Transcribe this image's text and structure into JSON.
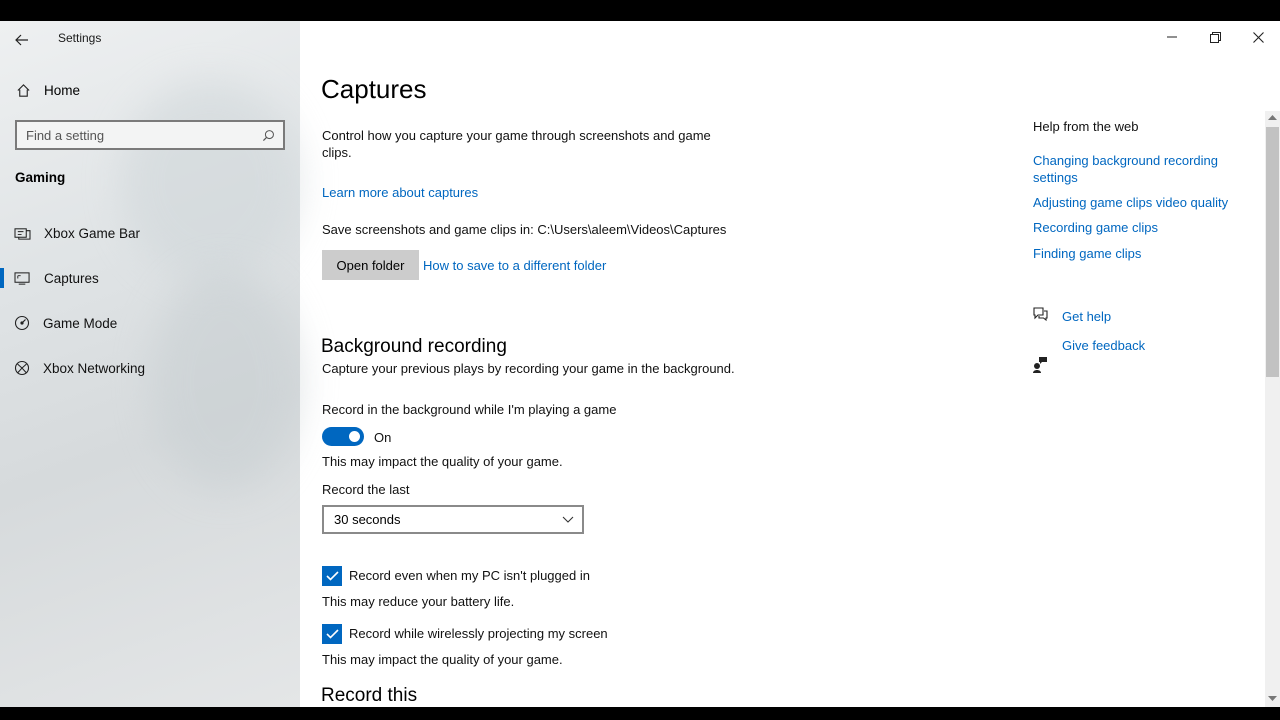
{
  "window": {
    "app_title": "Settings"
  },
  "sidebar": {
    "home_label": "Home",
    "search_placeholder": "Find a setting",
    "section_heading": "Gaming",
    "items": [
      {
        "label": "Xbox Game Bar",
        "icon": "xbox-game-bar-icon",
        "selected": false
      },
      {
        "label": "Captures",
        "icon": "captures-icon",
        "selected": true
      },
      {
        "label": "Game Mode",
        "icon": "game-mode-icon",
        "selected": false
      },
      {
        "label": "Xbox Networking",
        "icon": "xbox-icon",
        "selected": false
      }
    ]
  },
  "main": {
    "title": "Captures",
    "description": "Control how you capture your game through screenshots and game clips.",
    "learn_more_link": "Learn more about captures",
    "save_location_text": "Save screenshots and game clips in: C:\\Users\\aleem\\Videos\\Captures",
    "open_folder_label": "Open folder",
    "different_folder_link": "How to save to a different folder",
    "background_recording": {
      "heading": "Background recording",
      "description": "Capture your previous plays by recording your game in the background.",
      "toggle_label": "Record in the background while I'm playing a game",
      "toggle_state": "On",
      "toggle_note": "This may impact the quality of your game.",
      "record_last_label": "Record the last",
      "record_last_value": "30 seconds",
      "checkbox_plugged_label": "Record even when my PC isn't plugged in",
      "checkbox_plugged_note": "This may reduce your battery life.",
      "checkbox_projecting_label": "Record while wirelessly projecting my screen",
      "checkbox_projecting_note": "This may impact the quality of your game."
    },
    "record_this_heading": "Record this"
  },
  "help_panel": {
    "heading": "Help from the web",
    "links": [
      "Changing background recording settings",
      "Adjusting game clips video quality",
      "Recording game clips",
      "Finding game clips"
    ],
    "get_help_label": "Get help",
    "give_feedback_label": "Give feedback"
  },
  "colors": {
    "accent": "#0067c0",
    "sidebar_bg": "#e3e6e8",
    "button_bg": "#cccccc"
  }
}
